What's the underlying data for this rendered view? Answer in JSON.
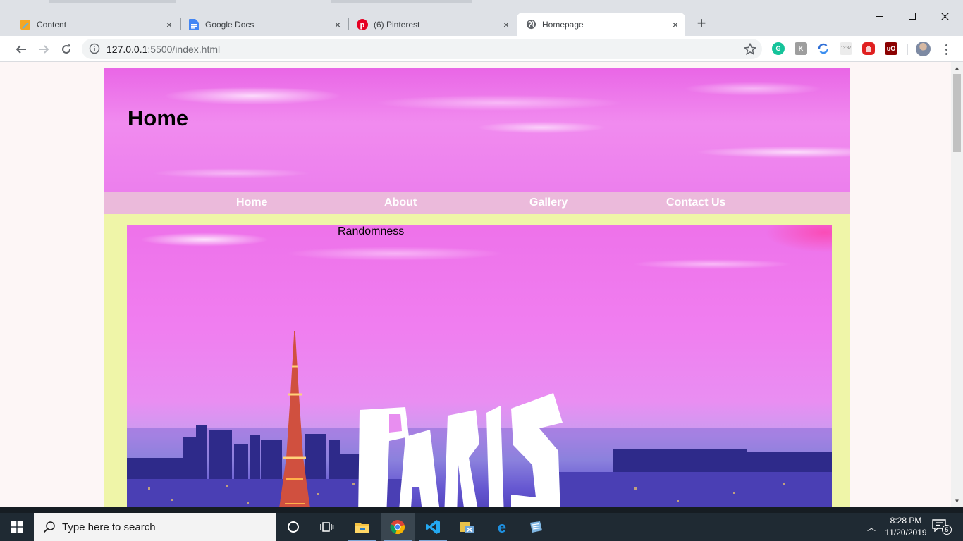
{
  "browser": {
    "tabs": [
      {
        "title": "Content",
        "favicon": "pencil-icon",
        "close": "×"
      },
      {
        "title": "Google Docs",
        "favicon": "google-docs-icon",
        "close": "×"
      },
      {
        "title": "(6) Pinterest",
        "favicon": "pinterest-icon",
        "close": "×"
      },
      {
        "title": "Homepage",
        "favicon": "globe-icon",
        "close": "×",
        "active": true
      }
    ],
    "new_tab": "+",
    "url_host": "127.0.0.1",
    "url_path": ":5500/index.html",
    "extensions": [
      "grammarly-icon",
      "extension-icon",
      "sync-icon",
      "clock-extension-icon",
      "adblock-icon",
      "ublock-icon"
    ],
    "clock_extension_label": "13:37"
  },
  "site": {
    "header_title": "Home",
    "nav": [
      "Home",
      "About",
      "Gallery",
      "Contact Us"
    ],
    "hero_caption": "Randomness",
    "hero_word": "PARIS",
    "colors": {
      "header_pink": "#ec7fed",
      "nav_bg": "#ebbadb",
      "main_bg": "#eff5a8",
      "page_bg": "#fdf6f6"
    }
  },
  "taskbar": {
    "search_placeholder": "Type here to search",
    "apps": [
      "cortana-icon",
      "task-view-icon",
      "file-explorer-icon",
      "chrome-icon",
      "vscode-icon",
      "app-icon",
      "edge-icon",
      "notepad-icon"
    ],
    "time": "8:28 PM",
    "date": "11/20/2019",
    "notification_count": "5"
  }
}
